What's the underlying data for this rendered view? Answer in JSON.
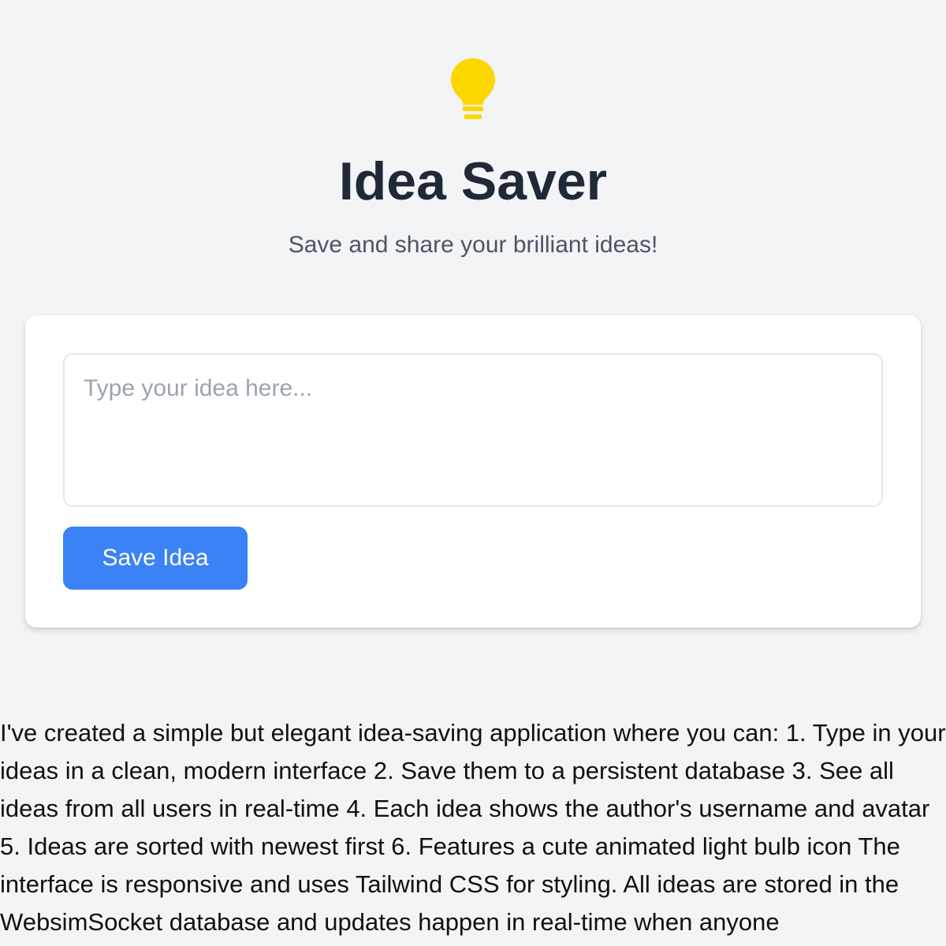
{
  "header": {
    "icon": "lightbulb-icon",
    "icon_color": "#fdd700",
    "title": "Idea Saver",
    "subtitle": "Save and share your brilliant ideas!"
  },
  "form": {
    "input_placeholder": "Type your idea here...",
    "input_value": "",
    "save_label": "Save Idea",
    "save_color": "#3b82f6"
  },
  "description": "I've created a simple but elegant idea-saving application where you can: 1. Type in your ideas in a clean, modern interface 2. Save them to a persistent database 3. See all ideas from all users in real-time 4. Each idea shows the author's username and avatar 5. Ideas are sorted with newest first 6. Features a cute animated light bulb icon The interface is responsive and uses Tailwind CSS for styling. All ideas are stored in the WebsimSocket database and updates happen in real-time when anyone"
}
